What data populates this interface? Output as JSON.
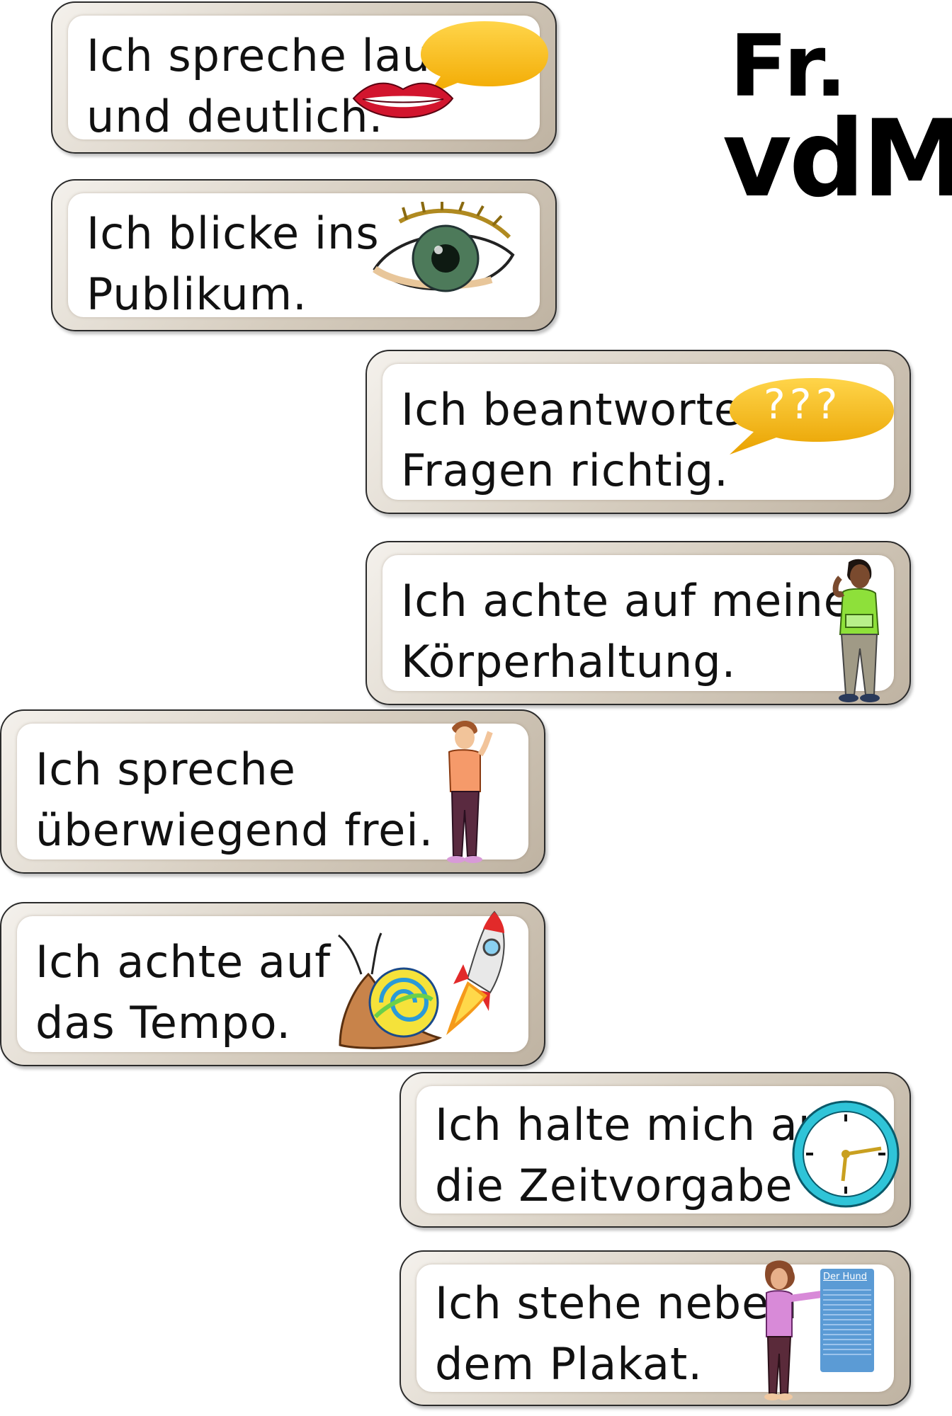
{
  "logo": {
    "line1": "Fr.",
    "line2": "vdM"
  },
  "cards": [
    {
      "line1": "Ich spreche laut",
      "line2": "und deutlich."
    },
    {
      "line1": "Ich blicke ins",
      "line2": "Publikum."
    },
    {
      "line1": "Ich beantworte",
      "line2": "Fragen richtig.",
      "bubble_text": "???"
    },
    {
      "line1": "Ich achte auf meine",
      "line2": "Körperhaltung."
    },
    {
      "line1": "Ich spreche",
      "line2": "überwiegend frei."
    },
    {
      "line1": "Ich achte auf",
      "line2": "das Tempo."
    },
    {
      "line1": "Ich halte mich an",
      "line2": "die Zeitvorgabe"
    },
    {
      "line1": "Ich stehe neben",
      "line2": "dem Plakat.",
      "poster_title": "Der Hund"
    }
  ],
  "colors": {
    "speech_bubble": "#f5bc00",
    "lips": "#d2152e",
    "iris": "#4d7a5a",
    "clock": "#2fc4d8",
    "poster": "#5b9bd5"
  },
  "icons": [
    "speech-bubble-icon",
    "lips-icon",
    "eye-icon",
    "question-bubble-icon",
    "girl-posture-icon",
    "boy-waving-icon",
    "snail-icon",
    "rocket-icon",
    "clock-icon",
    "girl-pointing-icon",
    "poster-icon"
  ]
}
